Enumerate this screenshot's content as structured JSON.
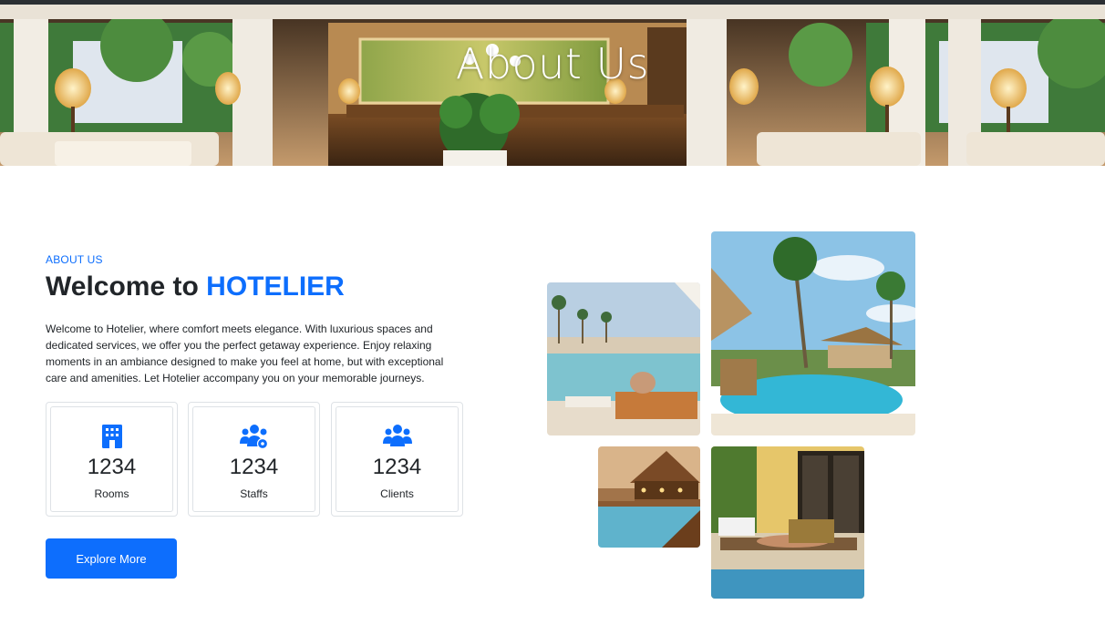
{
  "hero": {
    "title": "About Us"
  },
  "about": {
    "eyebrow": "ABOUT US",
    "headline_prefix": "Welcome to ",
    "headline_brand": "HOTELIER",
    "description": "Welcome to Hotelier, where comfort meets elegance. With luxurious spaces and dedicated services, we offer you the perfect getaway experience. Enjoy relaxing moments in an ambiance designed to make you feel at home, but with exceptional care and amenities. Let Hotelier accompany you on your memorable journeys."
  },
  "stats": [
    {
      "icon": "hotel-icon",
      "value": "1234",
      "label": "Rooms"
    },
    {
      "icon": "users-cog-icon",
      "value": "1234",
      "label": "Staffs"
    },
    {
      "icon": "users-icon",
      "value": "1234",
      "label": "Clients"
    }
  ],
  "cta": {
    "label": "Explore More"
  },
  "colors": {
    "accent": "#0d6efd",
    "text": "#212529",
    "border": "#dee2e6"
  }
}
